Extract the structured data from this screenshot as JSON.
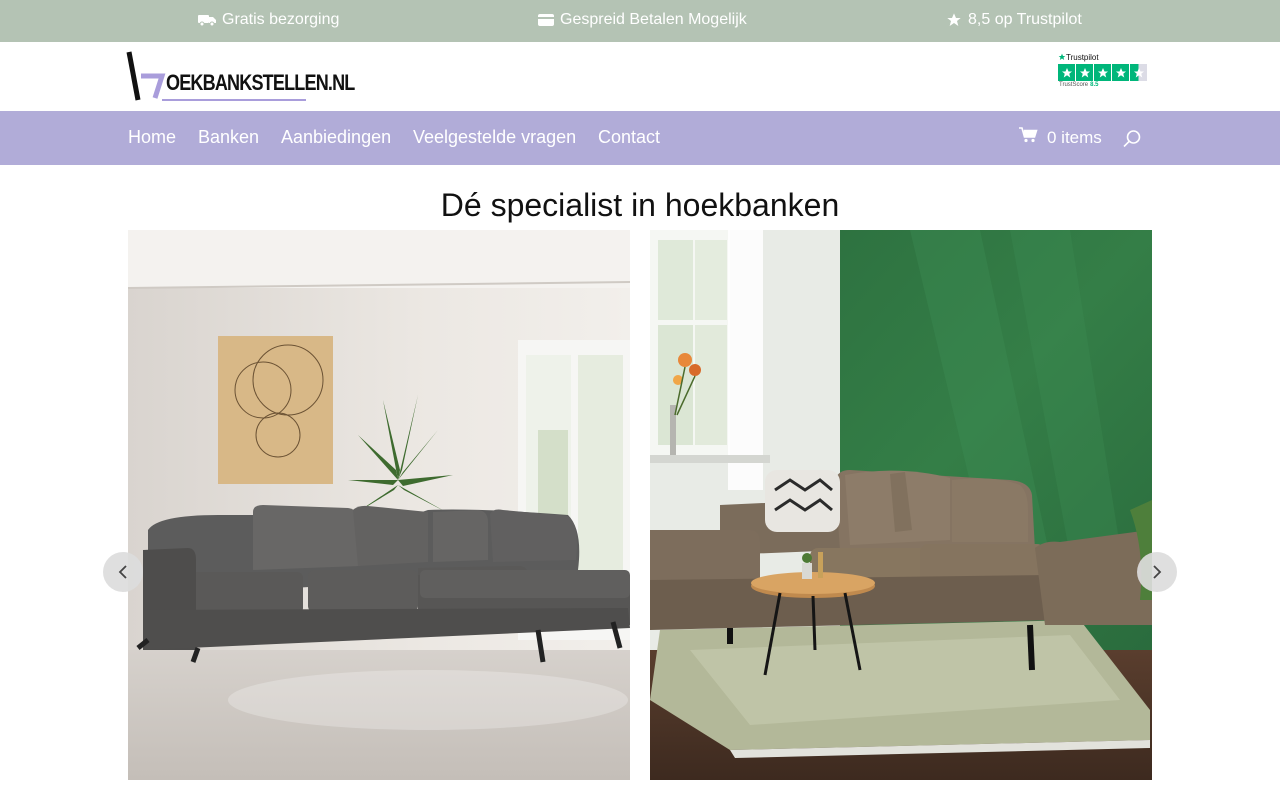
{
  "topbar": {
    "usp_1": {
      "icon": "truck-icon",
      "label": "Gratis bezorging"
    },
    "usp_2": {
      "icon": "credit-card-icon",
      "label": "Gespreid Betalen Mogelijk"
    },
    "usp_3": {
      "icon": "star-icon",
      "label": "8,5 op Trustpilot"
    }
  },
  "header": {
    "logo_text": "OEKBANKSTELLEN.NL",
    "trustpilot": {
      "name": "Trustpilot",
      "score_label": "TrustScore",
      "score": "8.5"
    }
  },
  "nav": {
    "items": [
      {
        "label": "Home"
      },
      {
        "label": "Banken"
      },
      {
        "label": "Aanbiedingen"
      },
      {
        "label": "Veelgestelde vragen"
      },
      {
        "label": "Contact"
      }
    ],
    "cart_label": "0 items"
  },
  "hero": {
    "title": "Dé specialist in hoekbanken"
  },
  "colors": {
    "topbar_bg": "#b4c3b4",
    "nav_bg": "#b1acd8",
    "trustpilot_green": "#00b67a",
    "feature_wall_green": "#2f7a44"
  }
}
